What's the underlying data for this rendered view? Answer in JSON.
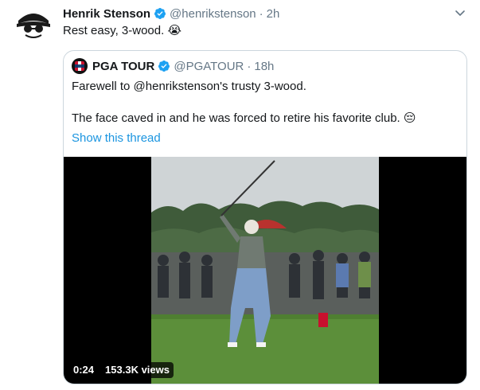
{
  "tweet": {
    "display_name": "Henrik Stenson",
    "handle": "@henrikstenson",
    "separator": "·",
    "time": "2h",
    "text": "Rest easy, 3-wood. 😭",
    "avatar_icon": "stenson-logo-avatar",
    "menu_icon": "chevron-down-icon"
  },
  "quote": {
    "display_name": "PGA TOUR",
    "handle": "@PGATOUR",
    "separator": "·",
    "time": "18h",
    "line1": "Farewell to @henrikstenson's trusty 3-wood.",
    "line2": "The face caved in and he was forced to retire his favorite club. 😔",
    "show_thread": "Show this thread",
    "video": {
      "duration": "0:24",
      "views": "153.3K views"
    }
  },
  "colors": {
    "text": "#14171a",
    "muted": "#657786",
    "link": "#1b95e0",
    "verified": "#1da1f2",
    "border": "#ccd6dd"
  }
}
